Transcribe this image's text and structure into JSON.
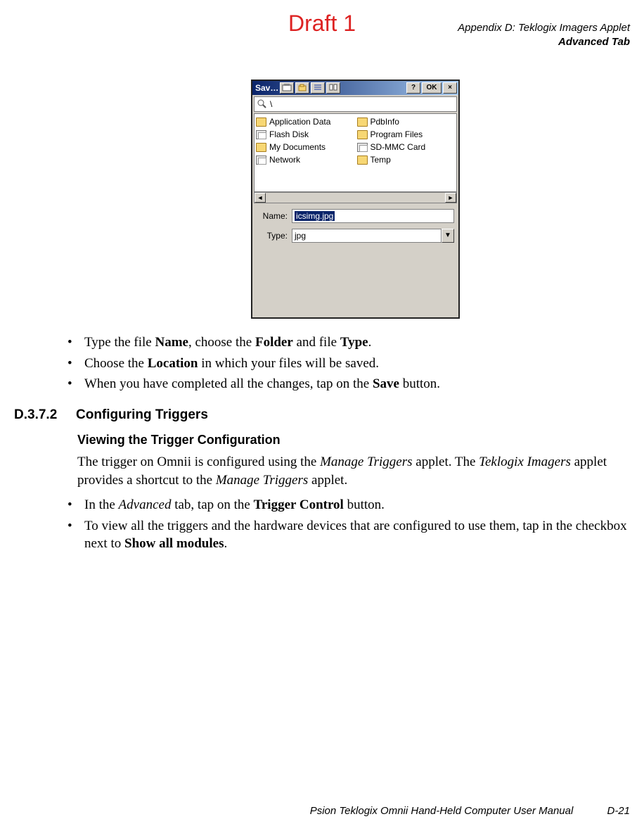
{
  "watermark": "Draft 1",
  "header": {
    "line1": "Appendix D: Teklogix Imagers Applet",
    "line2": "Advanced Tab"
  },
  "dialog": {
    "title": "Sav…",
    "buttons": {
      "help": "?",
      "ok": "OK",
      "close": "×"
    },
    "path": "\\",
    "filesLeft": [
      {
        "name": "Application Data",
        "iconType": "folder"
      },
      {
        "name": "Flash Disk",
        "iconType": "card"
      },
      {
        "name": "My Documents",
        "iconType": "folder"
      },
      {
        "name": "Network",
        "iconType": "card"
      }
    ],
    "filesRight": [
      {
        "name": "PdbInfo",
        "iconType": "folder"
      },
      {
        "name": "Program Files",
        "iconType": "folder"
      },
      {
        "name": "SD-MMC Card",
        "iconType": "card"
      },
      {
        "name": "Temp",
        "iconType": "folder"
      }
    ],
    "scroll": {
      "left": "◄",
      "right": "►"
    },
    "nameLabel": "Name:",
    "nameValue": "icsimg.jpg",
    "typeLabel": "Type:",
    "typeValue": "jpg",
    "comboArrow": "▼"
  },
  "bulletsTop": {
    "b1": {
      "pre": "Type the file ",
      "bold1": "Name",
      "mid1": ", choose the ",
      "bold2": "Folder",
      "mid2": " and file ",
      "bold3": "Type",
      "post": "."
    },
    "b2": {
      "pre": "Choose the ",
      "bold1": "Location",
      "post": " in which your files will be saved."
    },
    "b3": {
      "pre": "When you have completed all the changes, tap on the ",
      "bold1": "Save",
      "post": " button."
    }
  },
  "section": {
    "number": "D.3.7.2",
    "title": "Configuring Triggers"
  },
  "subsection": {
    "title": "Viewing the Trigger Configuration",
    "para": {
      "t1": "The trigger on Omnii is configured using the ",
      "i1": "Manage Triggers",
      "t2": " applet. The ",
      "i2": "Teklogix Imagers",
      "t3": " applet provides a shortcut to the ",
      "i3": "Manage Triggers",
      "t4": " applet."
    }
  },
  "bulletsBottom": {
    "b1": {
      "t1": "In the ",
      "i1": "Advanced",
      "t2": " tab, tap on the ",
      "b1": "Trigger Control",
      "t3": " button."
    },
    "b2": {
      "t1": "To view all the triggers and the hardware devices that are configured to use them, tap in the checkbox next to ",
      "b1": "Show all modules",
      "t2": "."
    }
  },
  "footer": {
    "text": "Psion Teklogix Omnii Hand-Held Computer User Manual",
    "page": "D-21"
  }
}
